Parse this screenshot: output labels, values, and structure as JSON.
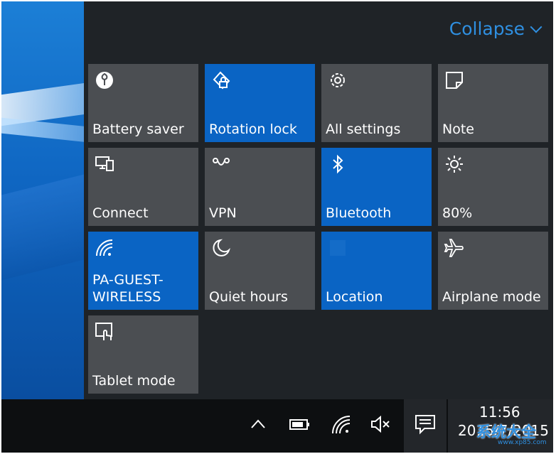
{
  "action_center": {
    "collapse_label": "Collapse",
    "tiles": [
      {
        "label": "Battery saver",
        "icon": "leaf-icon",
        "active": false
      },
      {
        "label": "Rotation lock",
        "icon": "rotation-lock-icon",
        "active": true
      },
      {
        "label": "All settings",
        "icon": "gear-icon",
        "active": false
      },
      {
        "label": "Note",
        "icon": "note-icon",
        "active": false
      },
      {
        "label": "Connect",
        "icon": "connect-icon",
        "active": false
      },
      {
        "label": "VPN",
        "icon": "vpn-icon",
        "active": false
      },
      {
        "label": "Bluetooth",
        "icon": "bluetooth-icon",
        "active": true
      },
      {
        "label": "80%",
        "icon": "brightness-icon",
        "active": false
      },
      {
        "label": "PA-GUEST-\nWIRELESS",
        "icon": "wifi-icon",
        "active": true
      },
      {
        "label": "Quiet hours",
        "icon": "moon-icon",
        "active": false
      },
      {
        "label": "Location",
        "icon": "location-icon",
        "active": true
      },
      {
        "label": "Airplane mode",
        "icon": "airplane-icon",
        "active": false
      },
      {
        "label": "Tablet mode",
        "icon": "tablet-mode-icon",
        "active": false
      }
    ]
  },
  "taskbar": {
    "time": "11:56",
    "date": "2015/7/2015"
  },
  "watermark": {
    "text": "系统大全",
    "url_text": "www.xp85.com"
  },
  "colors": {
    "accent": "#0a64c4",
    "tile_off": "#4b4e52",
    "panel": "#1f2327",
    "collapse": "#2f8fe0"
  }
}
